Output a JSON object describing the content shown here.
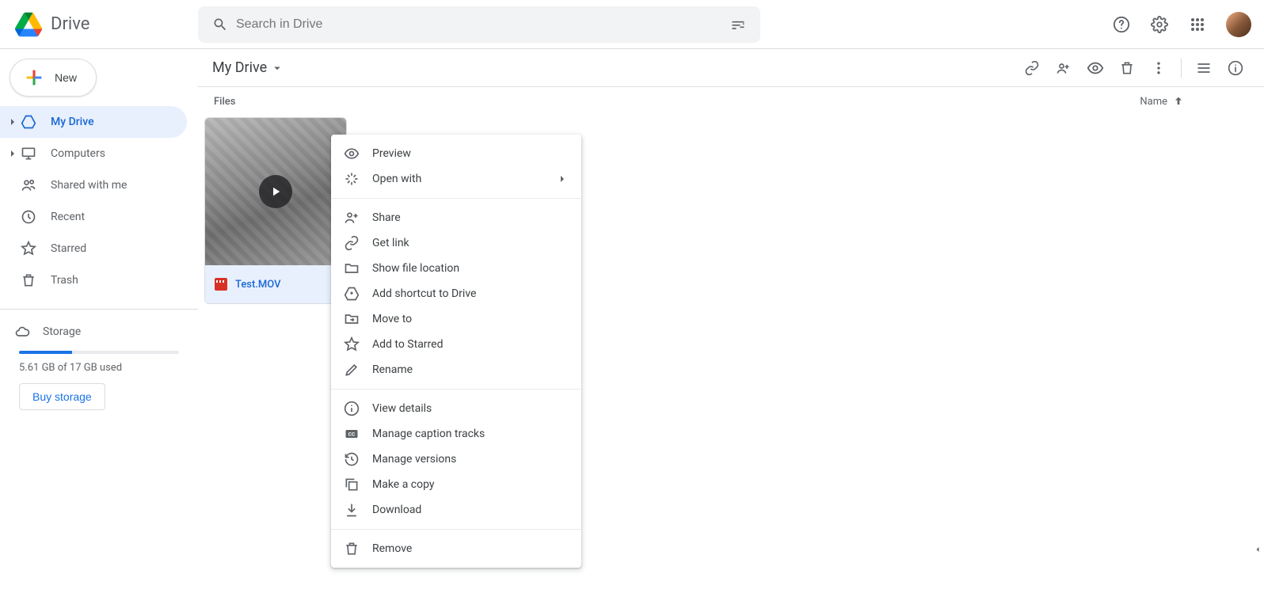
{
  "app": {
    "name": "Drive"
  },
  "search": {
    "placeholder": "Search in Drive"
  },
  "new_button": "New",
  "sidebar": {
    "items": [
      {
        "label": "My Drive"
      },
      {
        "label": "Computers"
      },
      {
        "label": "Shared with me"
      },
      {
        "label": "Recent"
      },
      {
        "label": "Starred"
      },
      {
        "label": "Trash"
      }
    ],
    "storage_label": "Storage",
    "storage_text": "5.61 GB of 17 GB used",
    "buy_label": "Buy storage"
  },
  "breadcrumb": "My Drive",
  "files_section_label": "Files",
  "sort_label": "Name",
  "file": {
    "name": "Test.MOV"
  },
  "menu": {
    "preview": "Preview",
    "open_with": "Open with",
    "share": "Share",
    "get_link": "Get link",
    "show_file_location": "Show file location",
    "add_shortcut": "Add shortcut to Drive",
    "move_to": "Move to",
    "add_to_starred": "Add to Starred",
    "rename": "Rename",
    "view_details": "View details",
    "manage_captions": "Manage caption tracks",
    "manage_versions": "Manage versions",
    "make_copy": "Make a copy",
    "download": "Download",
    "remove": "Remove"
  }
}
